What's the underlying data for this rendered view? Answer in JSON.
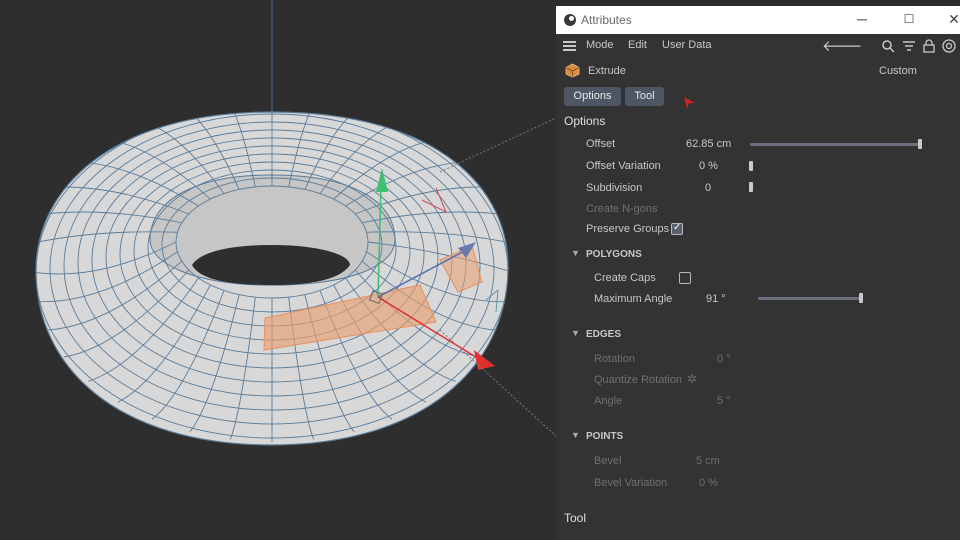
{
  "window": {
    "title": "Attributes",
    "minimize": "─",
    "maximize": "☐",
    "close": "✕"
  },
  "menubar": {
    "items": [
      "Mode",
      "Edit",
      "User Data"
    ],
    "icons": [
      "back-arrow-icon",
      "search-icon",
      "filter-icon",
      "lock-icon",
      "target-icon"
    ]
  },
  "object": {
    "name": "Extrude",
    "preset": "Custom"
  },
  "tabs": [
    "Options",
    "Tool"
  ],
  "options": {
    "heading": "Options",
    "offset": {
      "label": "Offset",
      "value": "62.85 cm",
      "fraction": 1.0
    },
    "offset_variation": {
      "label": "Offset Variation",
      "value": "0 %",
      "fraction": 0.0
    },
    "subdivision": {
      "label": "Subdivision",
      "value": "0",
      "fraction": 0.0
    },
    "create_ngons": {
      "label": "Create N-gons"
    },
    "preserve_groups": {
      "label": "Preserve Groups",
      "checked": true
    }
  },
  "polygons": {
    "heading": "POLYGONS",
    "create_caps": {
      "label": "Create Caps",
      "checked": false
    },
    "max_angle": {
      "label": "Maximum Angle",
      "value": "91 °",
      "fraction": 1.0
    }
  },
  "edges": {
    "heading": "EDGES",
    "rotation": {
      "label": "Rotation",
      "value": "0 °"
    },
    "quantize_rotation": {
      "label": "Quantize Rotation"
    },
    "angle": {
      "label": "Angle",
      "value": "5 °"
    }
  },
  "points": {
    "heading": "POINTS",
    "bevel": {
      "label": "Bevel",
      "value": "5 cm"
    },
    "bevel_variation": {
      "label": "Bevel Variation",
      "value": "0 %"
    }
  },
  "tool": {
    "heading": "Tool"
  },
  "colors": {
    "accent": "#4f5663",
    "viewport_bg": "#2e2e2e",
    "selection": "#e8a070"
  }
}
